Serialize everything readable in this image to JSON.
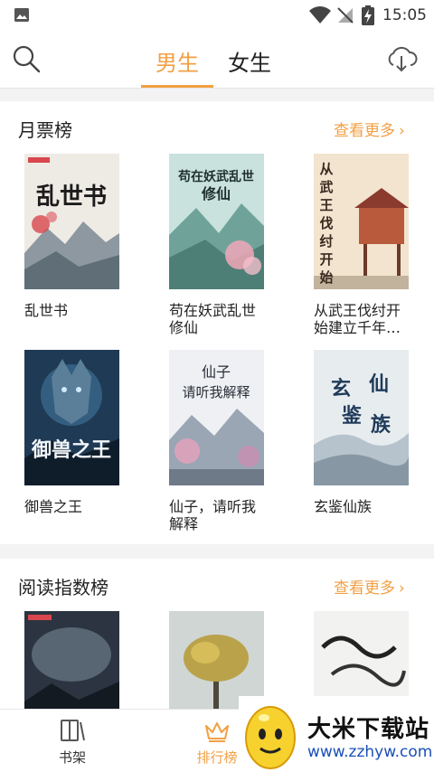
{
  "status_bar": {
    "time": "15:05"
  },
  "header": {
    "tabs": [
      {
        "label": "男生",
        "active": true
      },
      {
        "label": "女生",
        "active": false
      }
    ],
    "accent": "#f2a044"
  },
  "sections": [
    {
      "title": "月票榜",
      "more": "查看更多",
      "books": [
        {
          "title": "乱世书",
          "cover_text": "乱世书"
        },
        {
          "title": "苟在妖武乱世修仙",
          "cover_text": "苟在妖武乱世修仙"
        },
        {
          "title": "从武王伐纣开始建立千年…",
          "cover_text": "从武王伐纣开始"
        },
        {
          "title": "御兽之王",
          "cover_text": "御兽之王"
        },
        {
          "title": "仙子，请听我解释",
          "cover_text": "仙子请听我解释"
        },
        {
          "title": "玄鉴仙族",
          "cover_text": "玄鉴仙族"
        }
      ]
    },
    {
      "title": "阅读指数榜",
      "more": "查看更多"
    }
  ],
  "tab_bar": {
    "items": [
      {
        "label": "书架",
        "icon": "bookshelf-icon",
        "active": false
      },
      {
        "label": "排行榜",
        "icon": "crown-icon",
        "active": true
      }
    ]
  },
  "watermark": {
    "name": "大米下载站",
    "url": "www.zzhyw.com"
  }
}
